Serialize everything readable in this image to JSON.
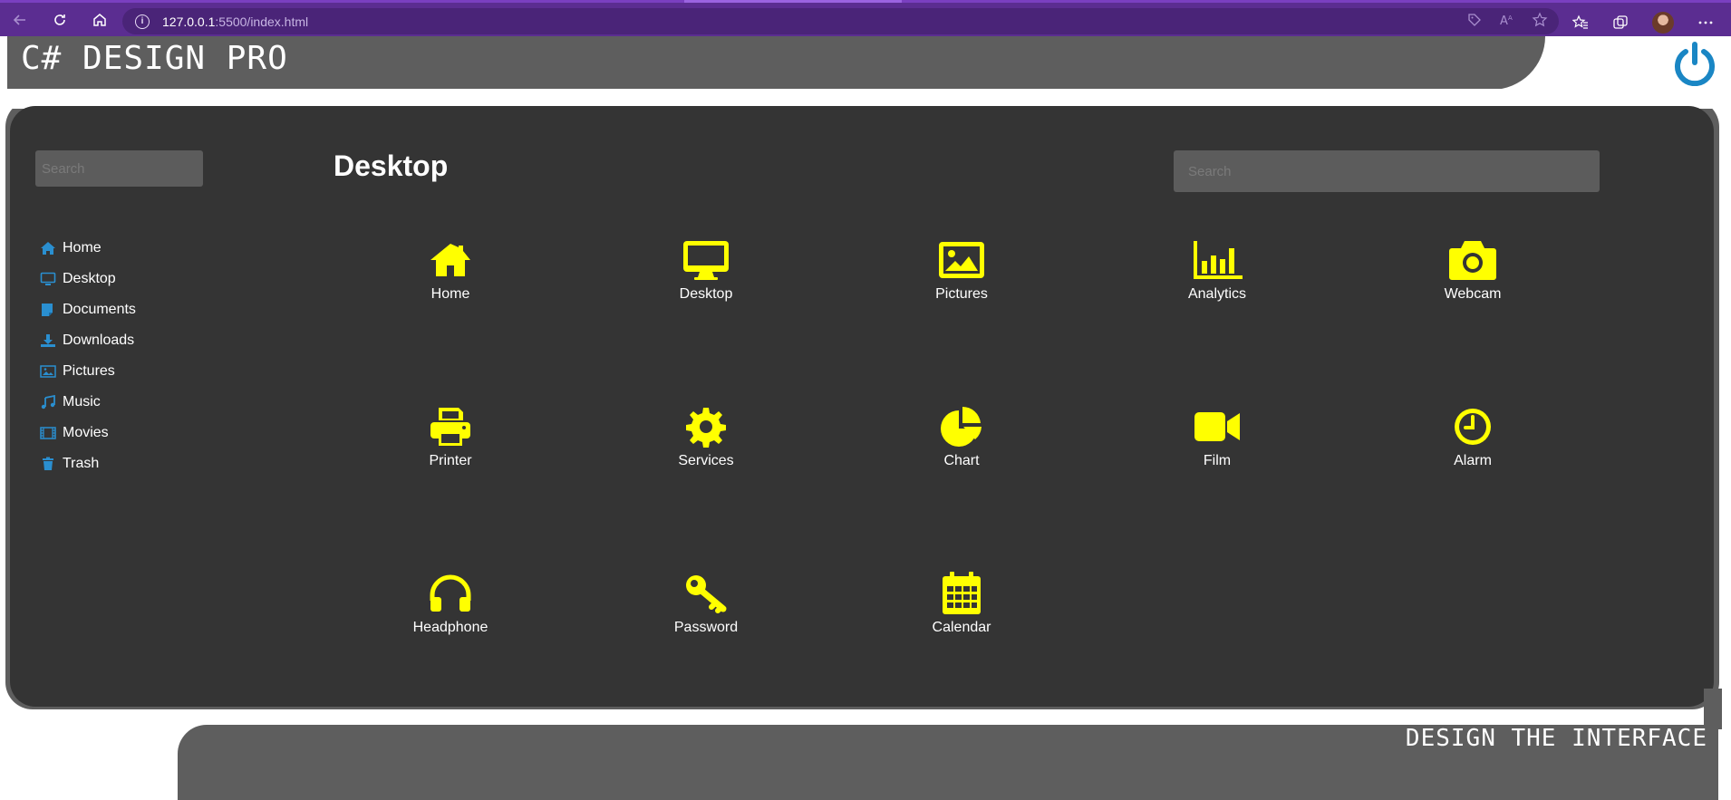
{
  "browser": {
    "url_host": "127.0.0.1",
    "url_rest": ":5500/index.html"
  },
  "header": {
    "brand": "C# DESIGN PRO"
  },
  "sidebar": {
    "search_placeholder": "Search",
    "items": [
      {
        "label": "Home",
        "icon": "home-icon"
      },
      {
        "label": "Desktop",
        "icon": "desktop-icon"
      },
      {
        "label": "Documents",
        "icon": "documents-icon"
      },
      {
        "label": "Downloads",
        "icon": "download-icon"
      },
      {
        "label": "Pictures",
        "icon": "pictures-icon"
      },
      {
        "label": "Music",
        "icon": "music-icon"
      },
      {
        "label": "Movies",
        "icon": "film-icon"
      },
      {
        "label": "Trash",
        "icon": "trash-icon"
      }
    ]
  },
  "main": {
    "title": "Desktop",
    "search_placeholder": "Search",
    "tiles": [
      {
        "label": "Home",
        "icon": "home-icon"
      },
      {
        "label": "Desktop",
        "icon": "desktop-icon"
      },
      {
        "label": "Pictures",
        "icon": "pictures-icon"
      },
      {
        "label": "Analytics",
        "icon": "bar-chart-icon"
      },
      {
        "label": "Webcam",
        "icon": "camera-icon"
      },
      {
        "label": "Printer",
        "icon": "printer-icon"
      },
      {
        "label": "Services",
        "icon": "gear-icon"
      },
      {
        "label": "Chart",
        "icon": "pie-chart-icon"
      },
      {
        "label": "Film",
        "icon": "video-camera-icon"
      },
      {
        "label": "Alarm",
        "icon": "clock-icon"
      },
      {
        "label": "Headphone",
        "icon": "headphones-icon"
      },
      {
        "label": "Password",
        "icon": "key-icon"
      },
      {
        "label": "Calendar",
        "icon": "calendar-icon"
      }
    ]
  },
  "footer": {
    "tagline": "DESIGN THE INTERFACE"
  },
  "colors": {
    "accent_icons": "#ffff00",
    "sidebar_icons": "#2a8fd0",
    "power_icon": "#1a86c4",
    "panel": "#343434",
    "header": "#5e5e5e",
    "browser_bar": "#5b2d91"
  }
}
